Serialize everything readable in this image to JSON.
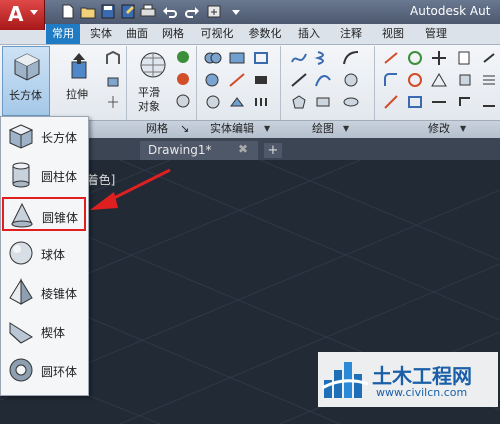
{
  "app": {
    "title": "Autodesk Aut",
    "logo_letter": "A"
  },
  "tabs": [
    {
      "label": "常用",
      "active": true
    },
    {
      "label": "实体"
    },
    {
      "label": "曲面"
    },
    {
      "label": "网格"
    },
    {
      "label": "可视化"
    },
    {
      "label": "参数化"
    },
    {
      "label": "插入"
    },
    {
      "label": "注释"
    },
    {
      "label": "视图"
    },
    {
      "label": "管理"
    }
  ],
  "ribbon": {
    "box_label": "长方体",
    "extrude_label": "拉伸",
    "smooth_label_line1": "平滑",
    "smooth_label_line2": "对象",
    "panels": {
      "mesh": "网格",
      "solid_edit": "实体编辑",
      "draw": "绘图",
      "modify": "修改"
    }
  },
  "document": {
    "tab_label": "Drawing1*",
    "close_glyph": "✖",
    "add_glyph": "+",
    "viewport_label": "[着色]"
  },
  "dropdown": {
    "items": [
      {
        "label": "长方体",
        "icon": "box-icon"
      },
      {
        "label": "圆柱体",
        "icon": "cylinder-icon"
      },
      {
        "label": "圆锥体",
        "icon": "cone-icon",
        "highlighted": true
      },
      {
        "label": "球体",
        "icon": "sphere-icon"
      },
      {
        "label": "棱锥体",
        "icon": "pyramid-icon"
      },
      {
        "label": "楔体",
        "icon": "wedge-icon"
      },
      {
        "label": "圆环体",
        "icon": "torus-icon"
      }
    ]
  },
  "watermark": {
    "title": "土木工程网",
    "url": "www.civilcn.com"
  },
  "colors": {
    "accent": "#1e7bc4",
    "highlight": "#e02020",
    "canvas": "#222a36"
  }
}
